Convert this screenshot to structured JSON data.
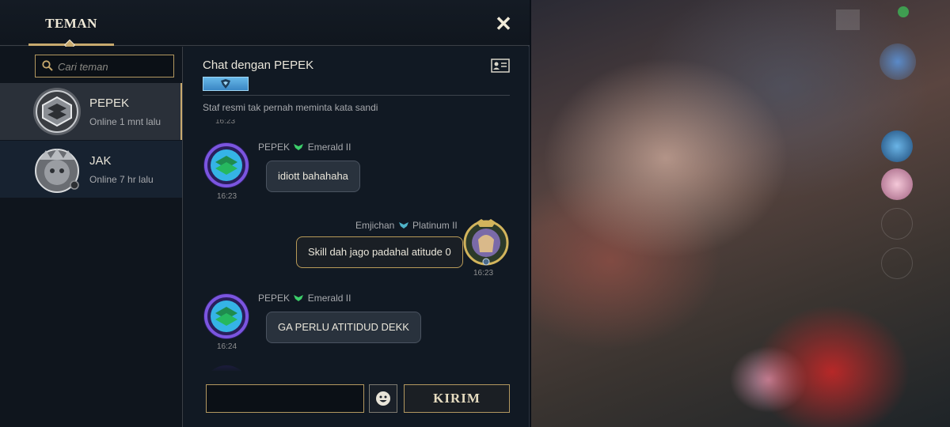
{
  "header": {
    "tab_label": "TEMAN",
    "close_label": "✕"
  },
  "search": {
    "placeholder": "Cari teman",
    "value": ""
  },
  "friends": [
    {
      "name": "PEPEK",
      "status": "Online 1 mnt lalu",
      "selected": true
    },
    {
      "name": "JAK",
      "status": "Online 7 hr lalu",
      "selected": false
    }
  ],
  "chat": {
    "title": "Chat dengan PEPEK",
    "notice": "Staf resmi tak pernah meminta kata sandi",
    "truncated_top_time": "16:23",
    "messages": [
      {
        "sender": "PEPEK",
        "rank": "Emerald II",
        "text": "idiott bahahaha",
        "time": "16:23",
        "direction": "incoming",
        "rank_color": "#3ccf6a"
      },
      {
        "sender": "Emjichan",
        "rank": "Platinum II",
        "text": "Skill dah jago padahal atitude 0",
        "time": "16:23",
        "direction": "outgoing",
        "rank_color": "#4fb3c8"
      },
      {
        "sender": "PEPEK",
        "rank": "Emerald II",
        "text": "GA PERLU ATITIDUD DEKK",
        "time": "16:24",
        "direction": "incoming",
        "rank_color": "#3ccf6a"
      }
    ],
    "input_value": "",
    "send_label": "KIRIM"
  },
  "colors": {
    "accent_gold": "#c8aa6e",
    "panel_bg": "#111821",
    "bubble_in": "#29323d"
  },
  "icons": {
    "search": "search-icon",
    "close": "close-icon",
    "profile_card": "profile-card-icon",
    "emoji": "emoji-icon"
  }
}
